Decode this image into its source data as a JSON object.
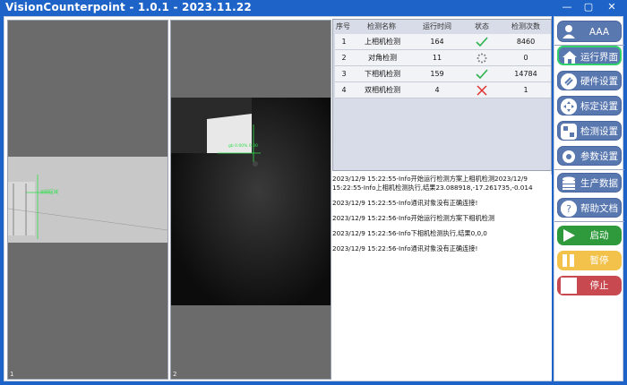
{
  "window": {
    "title": "VisionCounterpoint - 1.0.1 - 2023.11.22"
  },
  "cameras": [
    {
      "label": "1",
      "tag": "识别区域"
    },
    {
      "label": "2",
      "tag": "gb 0.00% 0.00"
    }
  ],
  "table": {
    "headers": [
      "序号",
      "检测名称",
      "运行时间",
      "状态",
      "检测次数"
    ],
    "rows": [
      {
        "id": "1",
        "name": "上相机检测",
        "time": "164",
        "status": "ok",
        "count": "8460"
      },
      {
        "id": "2",
        "name": "对角检测",
        "time": "11",
        "status": "loading",
        "count": "0"
      },
      {
        "id": "3",
        "name": "下相机检测",
        "time": "159",
        "status": "ok",
        "count": "14784"
      },
      {
        "id": "4",
        "name": "双相机检测",
        "time": "4",
        "status": "error",
        "count": "1"
      }
    ]
  },
  "log": [
    "2023/12/9 15:22:55-Info开始运行检测方案上相机检测2023/12/9 15:22:55-Info上相机检测执行,结果23.088918,-17.261735,-0.014",
    "2023/12/9 15:22:55-Info通讯对象没有正确连接!",
    "2023/12/9 15:22:56-Info开始运行检测方案下相机检测",
    "2023/12/9 15:22:56-Info下相机检测执行,结果0,0,0",
    "2023/12/9 15:22:56-Info通讯对象没有正确连接!"
  ],
  "sidebar": {
    "user": "AAA",
    "nav": [
      "运行界面",
      "硬件设置",
      "标定设置",
      "检测设置",
      "参数设置"
    ],
    "tools": [
      "生产数据",
      "帮助文档"
    ],
    "actions": [
      {
        "label": "启动",
        "color": "#2f9a3c"
      },
      {
        "label": "暂停",
        "color": "#f2c24a"
      },
      {
        "label": "停止",
        "color": "#c84a50"
      }
    ]
  },
  "colors": {
    "accent": "#1e64c8",
    "ok": "#2bb24c",
    "error": "#e03030",
    "active_border": "#2fd06a"
  }
}
